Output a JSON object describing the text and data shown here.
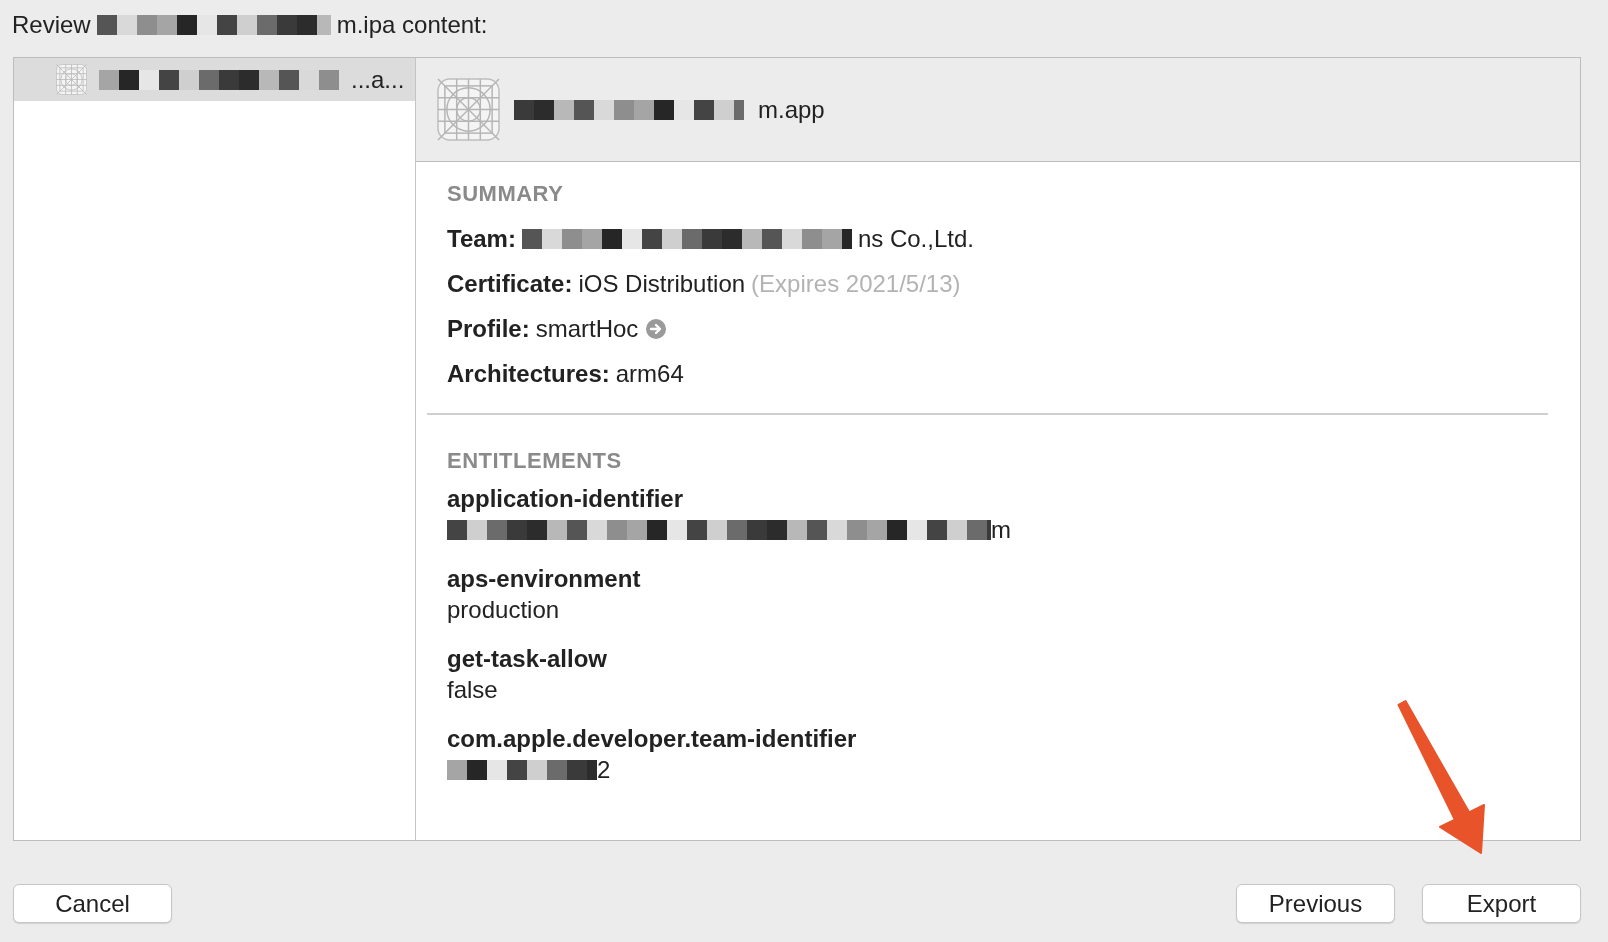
{
  "title": {
    "lead": "Review",
    "tail": "m.ipa content:"
  },
  "sidebar": {
    "items": [
      {
        "label": "...a...",
        "selected": true
      }
    ]
  },
  "header": {
    "app_name": "m.app"
  },
  "summary": {
    "heading": "SUMMARY",
    "rows": [
      {
        "label": "Team:",
        "value": "ns Co.,Ltd.",
        "redacted": true,
        "link": false
      },
      {
        "label": "Certificate:",
        "value": "iOS Distribution",
        "note": "(Expires 2021/5/13)",
        "redacted": false,
        "link": false
      },
      {
        "label": "Profile:",
        "value": "smartHoc",
        "redacted": false,
        "link": true
      },
      {
        "label": "Architectures:",
        "value": "arm64",
        "redacted": false,
        "link": false
      }
    ]
  },
  "entitlements": {
    "heading": "ENTITLEMENTS",
    "items": [
      {
        "key": "application-identifier",
        "value": "m",
        "redacted": true
      },
      {
        "key": "aps-environment",
        "value": "production",
        "redacted": false
      },
      {
        "key": "get-task-allow",
        "value": "false",
        "redacted": false
      },
      {
        "key": "com.apple.developer.team-identifier",
        "value": "2",
        "redacted": true
      }
    ]
  },
  "footer": {
    "left_buttons": [
      "Cancel"
    ],
    "right_buttons": [
      "Previous",
      "Export"
    ]
  }
}
